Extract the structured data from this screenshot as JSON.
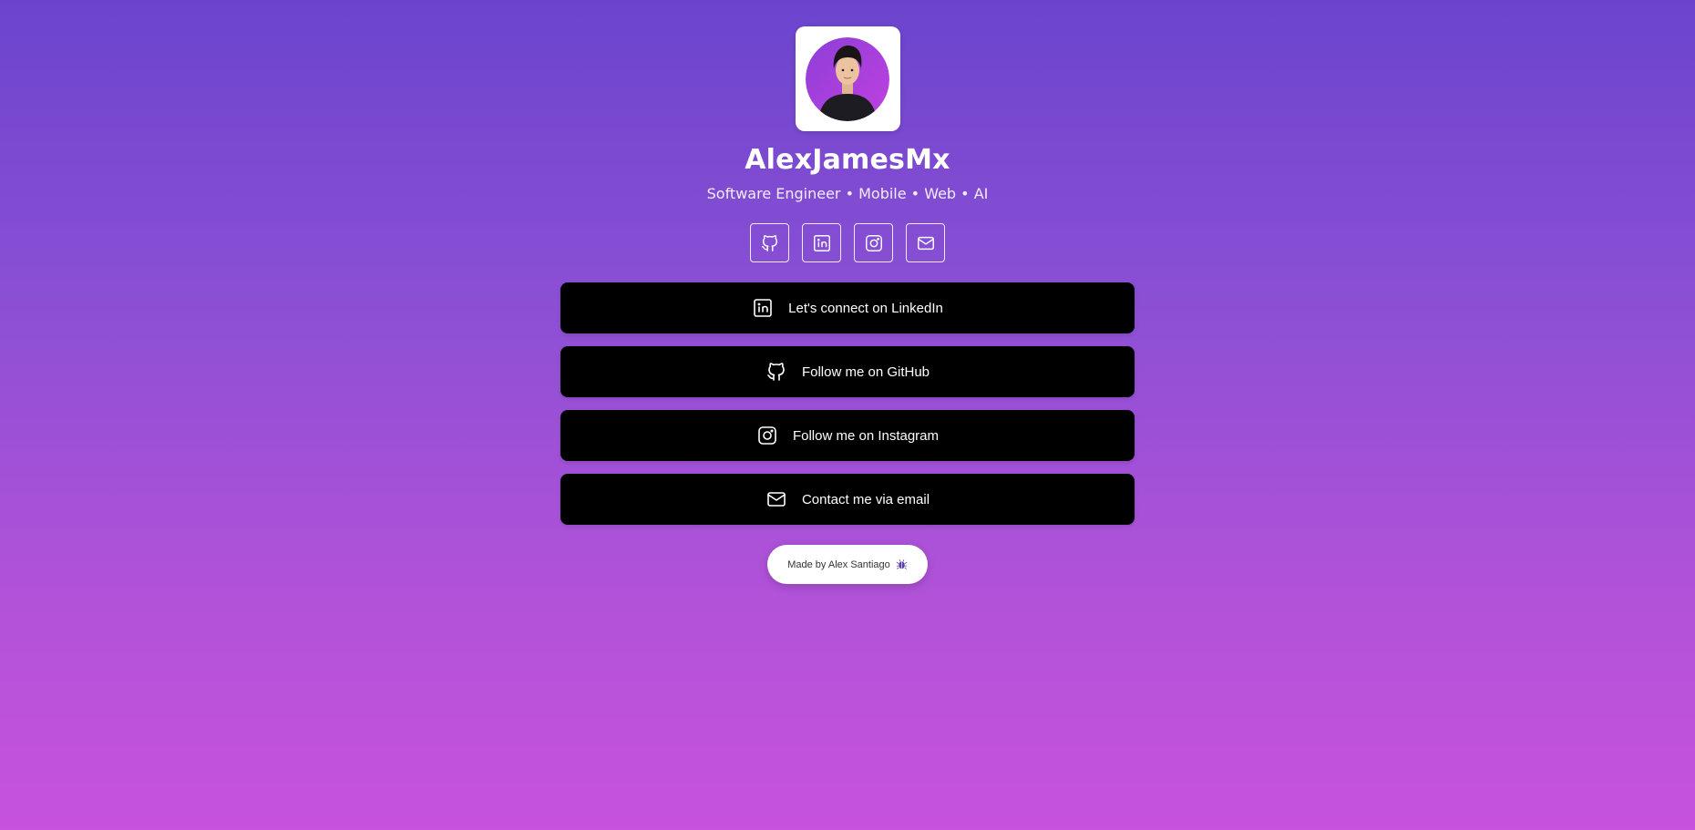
{
  "profile": {
    "name": "AlexJamesMx",
    "tagline": "Software Engineer • Mobile • Web • AI",
    "avatar_alt": "profile-photo"
  },
  "socials": [
    {
      "name": "github",
      "icon": "github-icon"
    },
    {
      "name": "linkedin",
      "icon": "linkedin-icon"
    },
    {
      "name": "instagram",
      "icon": "instagram-icon"
    },
    {
      "name": "email",
      "icon": "mail-icon"
    }
  ],
  "links": [
    {
      "label": "Let's connect on LinkedIn",
      "icon": "linkedin-icon"
    },
    {
      "label": "Follow me on GitHub",
      "icon": "github-icon"
    },
    {
      "label": "Follow me on Instagram",
      "icon": "instagram-icon"
    },
    {
      "label": "Contact me via email",
      "icon": "mail-icon"
    }
  ],
  "footer": {
    "made_by": "Made by Alex Santiago",
    "icon": "bug-icon"
  },
  "colors": {
    "gradient_top": "#6b44cd",
    "gradient_bottom": "#c752dc",
    "button_bg": "#000000",
    "text": "#ffffff"
  }
}
